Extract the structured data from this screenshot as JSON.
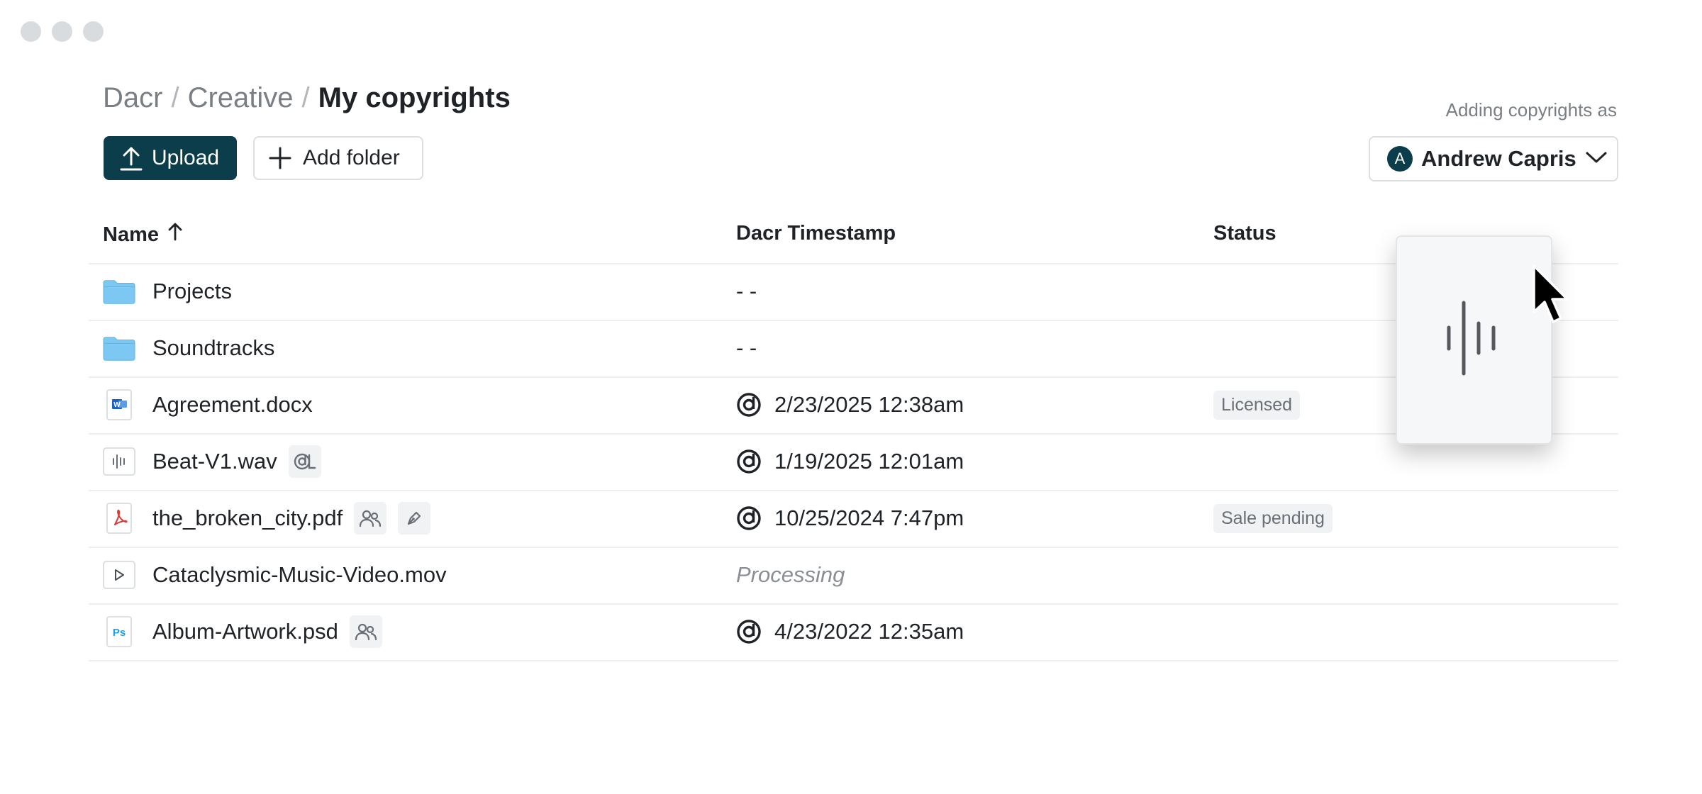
{
  "window": {
    "controls": [
      "close",
      "minimize",
      "maximize"
    ]
  },
  "breadcrumb": {
    "items": [
      "Dacr",
      "Creative"
    ],
    "separator": "/",
    "current": "My copyrights"
  },
  "toolbar": {
    "upload_label": "Upload",
    "add_folder_label": "Add folder"
  },
  "account": {
    "caption": "Adding copyrights as",
    "avatar_initial": "A",
    "name": "Andrew Capris"
  },
  "table": {
    "columns": {
      "name": "Name",
      "timestamp": "Dacr Timestamp",
      "status": "Status"
    },
    "sort": {
      "column": "Name",
      "direction": "ascending"
    },
    "rows": [
      {
        "name": "Projects",
        "icon": "folder-icon",
        "timestamp": "- -",
        "status": "",
        "badges": []
      },
      {
        "name": "Soundtracks",
        "icon": "folder-icon",
        "timestamp": "- -",
        "status": "",
        "badges": []
      },
      {
        "name": "Agreement.docx",
        "icon": "word-doc-icon",
        "timestamp": "2/23/2025 12:38am",
        "status": "Licensed",
        "badges": []
      },
      {
        "name": "Beat-V1.wav",
        "icon": "audio-waveform-icon",
        "timestamp": "1/19/2025 12:01am",
        "status": "",
        "badges": [
          "copyright-license-icon"
        ]
      },
      {
        "name": "the_broken_city.pdf",
        "icon": "pdf-icon",
        "timestamp": "10/25/2024 7:47pm",
        "status": "Sale pending",
        "badges": [
          "users-icon",
          "pen-icon"
        ]
      },
      {
        "name": "Cataclysmic-Music-Video.mov",
        "icon": "video-play-icon",
        "timestamp": "Processing",
        "status": "",
        "badges": []
      },
      {
        "name": "Album-Artwork.psd",
        "icon": "photoshop-icon",
        "timestamp": "4/23/2022 12:35am",
        "status": "",
        "badges": [
          "users-icon"
        ]
      }
    ]
  },
  "drag_preview": {
    "icon": "audio-waveform-icon"
  },
  "colors": {
    "primary": "#0b3d4b",
    "folder": "#7cc8f2",
    "pdf": "#d93b3b",
    "word": "#1f5fc2",
    "photoshop": "#1ea0e6"
  }
}
